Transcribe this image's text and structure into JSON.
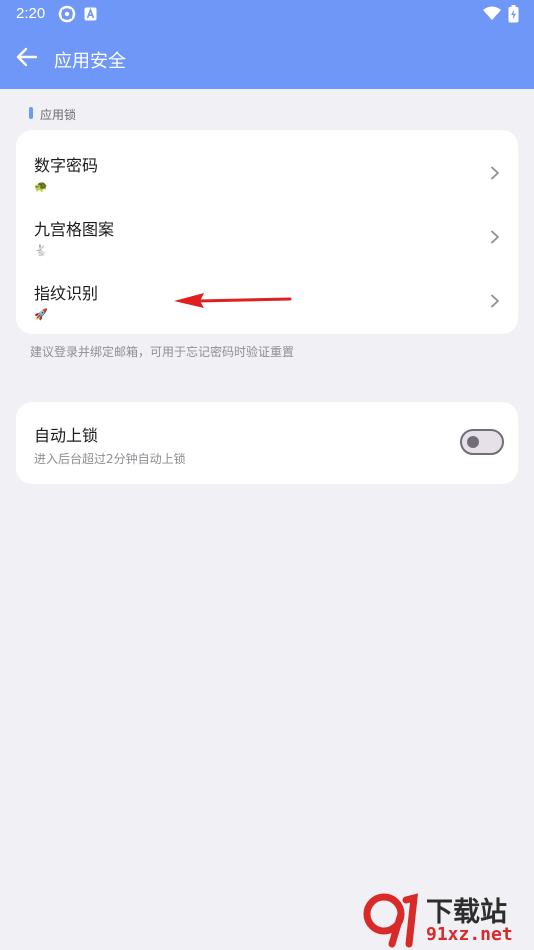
{
  "status_bar": {
    "time": "2:20",
    "icons": [
      "sync-icon",
      "a-box-icon",
      "wifi-icon",
      "battery-charging-icon"
    ]
  },
  "app_bar": {
    "title": "应用安全",
    "back_icon": "arrow-left-icon",
    "background": "#6e97f8"
  },
  "app_lock_section": {
    "header": "应用锁",
    "items": [
      {
        "title": "数字密码",
        "emoji": "🐢",
        "icon": "chevron-right-icon"
      },
      {
        "title": "九宫格图案",
        "emoji": "🐇",
        "icon": "chevron-right-icon"
      },
      {
        "title": "指纹识别",
        "emoji": "🚀",
        "icon": "chevron-right-icon"
      }
    ],
    "hint": "建议登录并绑定邮箱，可用于忘记密码时验证重置"
  },
  "auto_lock": {
    "title": "自动上锁",
    "subtitle": "进入后台超过2分钟自动上锁",
    "enabled": false
  },
  "annotation": {
    "icon": "red-arrow-icon",
    "color": "#e02020"
  },
  "watermark": {
    "text": "下载站",
    "url": "91xz.net"
  }
}
